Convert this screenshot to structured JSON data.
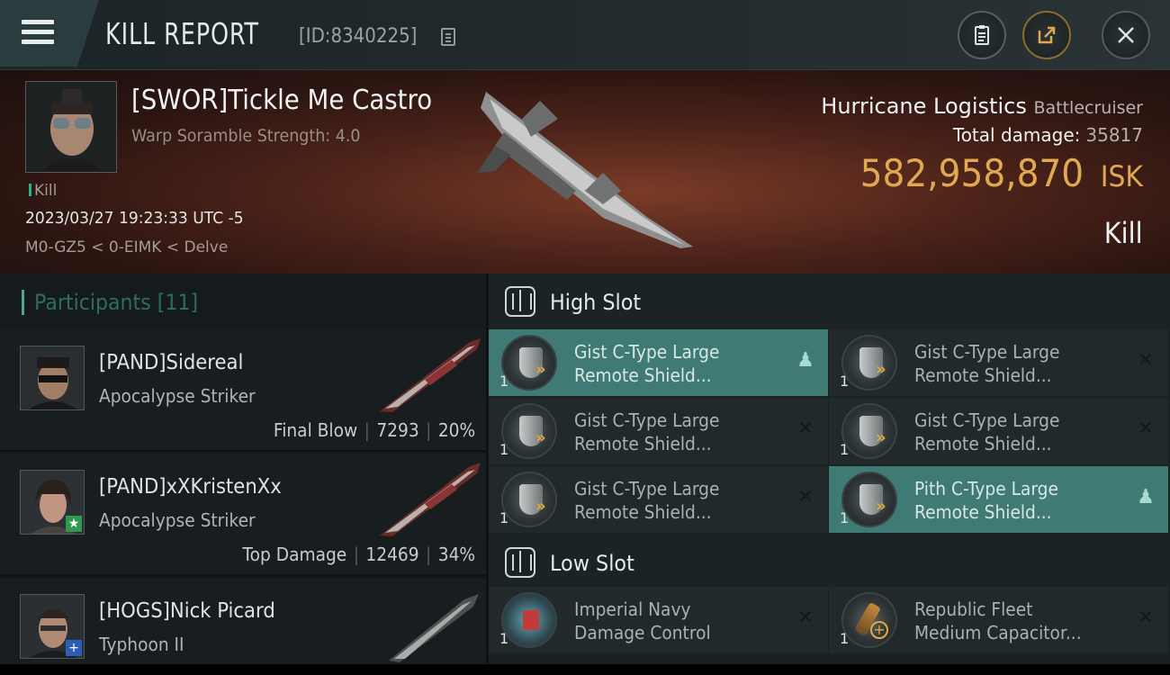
{
  "header": {
    "title": "KILL REPORT",
    "report_id": "[ID:8340225]",
    "menu_icon": "hamburger-menu-icon",
    "buttons": {
      "clipboard": "clipboard-icon",
      "share": "share-external-icon",
      "close": "close-icon"
    }
  },
  "victim": {
    "name": "[SWOR]Tickle Me Castro",
    "subtitle": "Warp Soramble Strength: 4.0",
    "tag": "Kill",
    "date": "2023/03/27 19:23:33 UTC -5",
    "location": "M0-GZ5 < 0-EIMK < Delve",
    "ship": "Hurricane Logistics",
    "ship_class": "Battlecruiser",
    "total_damage_label": "Total damage:",
    "total_damage": "35817",
    "isk_value": "582,958,870",
    "isk_unit": "ISK",
    "kill_type": "Kill"
  },
  "participants": {
    "title": "Participants",
    "count": "[11]",
    "items": [
      {
        "name": "[PAND]Sidereal",
        "ship": "Apocalypse Striker",
        "role": "Final Blow",
        "damage": "7293",
        "percent": "20%",
        "badge": ""
      },
      {
        "name": "[PAND]xXKristenXx",
        "ship": "Apocalypse Striker",
        "role": "Top Damage",
        "damage": "12469",
        "percent": "34%",
        "badge": "★"
      },
      {
        "name": "[HOGS]Nick Picard",
        "ship": "Typhoon II",
        "role": "",
        "damage": "",
        "percent": "",
        "badge": "+"
      }
    ]
  },
  "slots": {
    "high": {
      "title": "High Slot",
      "modules": [
        {
          "line1": "Gist C-Type Large",
          "line2": "Remote Shield...",
          "qty": "1",
          "selected": true
        },
        {
          "line1": "Gist C-Type Large",
          "line2": "Remote Shield...",
          "qty": "1",
          "selected": false
        },
        {
          "line1": "Gist C-Type Large",
          "line2": "Remote Shield...",
          "qty": "1",
          "selected": false
        },
        {
          "line1": "Gist C-Type Large",
          "line2": "Remote Shield...",
          "qty": "1",
          "selected": false
        },
        {
          "line1": "Gist C-Type Large",
          "line2": "Remote Shield...",
          "qty": "1",
          "selected": false
        },
        {
          "line1": "Pith C-Type Large",
          "line2": "Remote Shield...",
          "qty": "1",
          "selected": true
        }
      ]
    },
    "low": {
      "title": "Low Slot",
      "modules": [
        {
          "line1": "Imperial Navy",
          "line2": "Damage Control",
          "qty": "1",
          "selected": false
        },
        {
          "line1": "Republic Fleet",
          "line2": "Medium Capacitor...",
          "qty": "1",
          "selected": false
        }
      ]
    }
  },
  "colors": {
    "accent_teal": "#3f7b74",
    "isk_gold": "#e0a951",
    "background": "#0d1215"
  }
}
